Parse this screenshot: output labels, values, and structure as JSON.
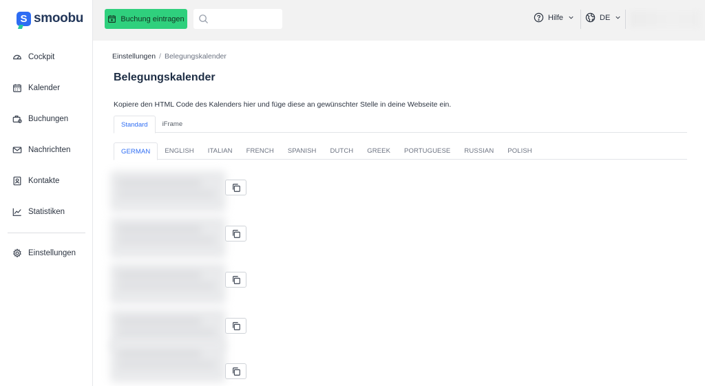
{
  "brand": {
    "name": "smoobu",
    "mark": "S"
  },
  "sidebar": {
    "items": [
      {
        "label": "Cockpit",
        "icon": "gauge-icon"
      },
      {
        "label": "Kalender",
        "icon": "calendar-icon"
      },
      {
        "label": "Buchungen",
        "icon": "suitcase-icon"
      },
      {
        "label": "Nachrichten",
        "icon": "mail-icon"
      },
      {
        "label": "Kontakte",
        "icon": "contact-card-icon"
      },
      {
        "label": "Statistiken",
        "icon": "chart-line-icon"
      }
    ],
    "settings": {
      "label": "Einstellungen",
      "icon": "gear-icon"
    }
  },
  "topbar": {
    "book_button": "Buchung eintragen",
    "search_placeholder": "",
    "help_label": "Hilfe",
    "language": "DE"
  },
  "breadcrumb": {
    "parent": "Einstellungen",
    "separator": "/",
    "current": "Belegungskalender"
  },
  "page": {
    "title": "Belegungskalender",
    "description": "Kopiere den HTML Code des Kalenders hier und füge diese an gewünschter Stelle in deine Webseite ein."
  },
  "embed_tabs": [
    "Standard",
    "iFrame"
  ],
  "language_tabs": [
    "GERMAN",
    "ENGLISH",
    "ITALIAN",
    "FRENCH",
    "SPANISH",
    "DUTCH",
    "GREEK",
    "PORTUGUESE",
    "RUSSIAN",
    "POLISH"
  ],
  "colors": {
    "accent": "#2d6cf3",
    "primary_button": "#2fd07d",
    "topbar_bg": "#f2f2f2"
  }
}
